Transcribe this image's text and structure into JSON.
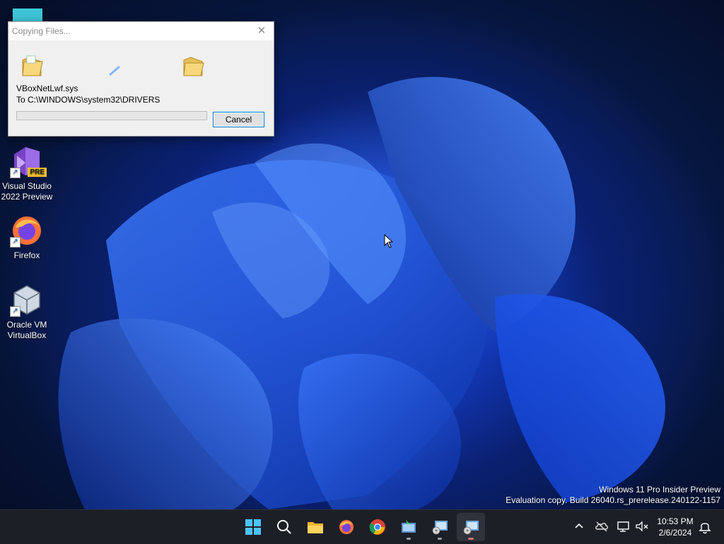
{
  "desktop": {
    "icons": [
      {
        "label_line1": "Visual Studio",
        "label_line2": "2022 Preview",
        "icon": "visual-studio-preview-icon",
        "badge": "PRE"
      },
      {
        "label_line1": "Firefox",
        "label_line2": "",
        "icon": "firefox-icon"
      },
      {
        "label_line1": "Oracle VM",
        "label_line2": "VirtualBox",
        "icon": "virtualbox-icon"
      }
    ],
    "watermark": {
      "line1": "Windows 11 Pro Insider Preview",
      "line2": "Evaluation copy. Build 26040.rs_prerelease.240122-1157"
    }
  },
  "dialog": {
    "title": "Copying Files...",
    "close_icon": "close-icon",
    "file_name": "VBoxNetLwf.sys",
    "destination": "To C:\\WINDOWS\\system32\\DRIVERS",
    "progress": 0,
    "cancel_label": "Cancel"
  },
  "taskbar": {
    "apps": [
      {
        "name": "start",
        "icon": "windows-start-icon"
      },
      {
        "name": "search",
        "icon": "search-icon"
      },
      {
        "name": "file-explorer",
        "icon": "folder-icon"
      },
      {
        "name": "firefox",
        "icon": "firefox-icon"
      },
      {
        "name": "chrome",
        "icon": "chrome-icon"
      },
      {
        "name": "installer",
        "icon": "installer-icon"
      },
      {
        "name": "setup",
        "icon": "setup-disc-icon"
      },
      {
        "name": "setup-active",
        "icon": "setup-disc-icon"
      }
    ],
    "tray": {
      "icons": [
        "chevron-up-icon",
        "onedrive-icon",
        "network-icon",
        "volume-muted-icon",
        "notification-bell-icon"
      ],
      "time": "10:53 PM",
      "date": "2/6/2024"
    }
  },
  "colors": {
    "accent": "#0078d7",
    "taskbar_bg": "#1c1f26",
    "progress_fill": "#06b025"
  }
}
